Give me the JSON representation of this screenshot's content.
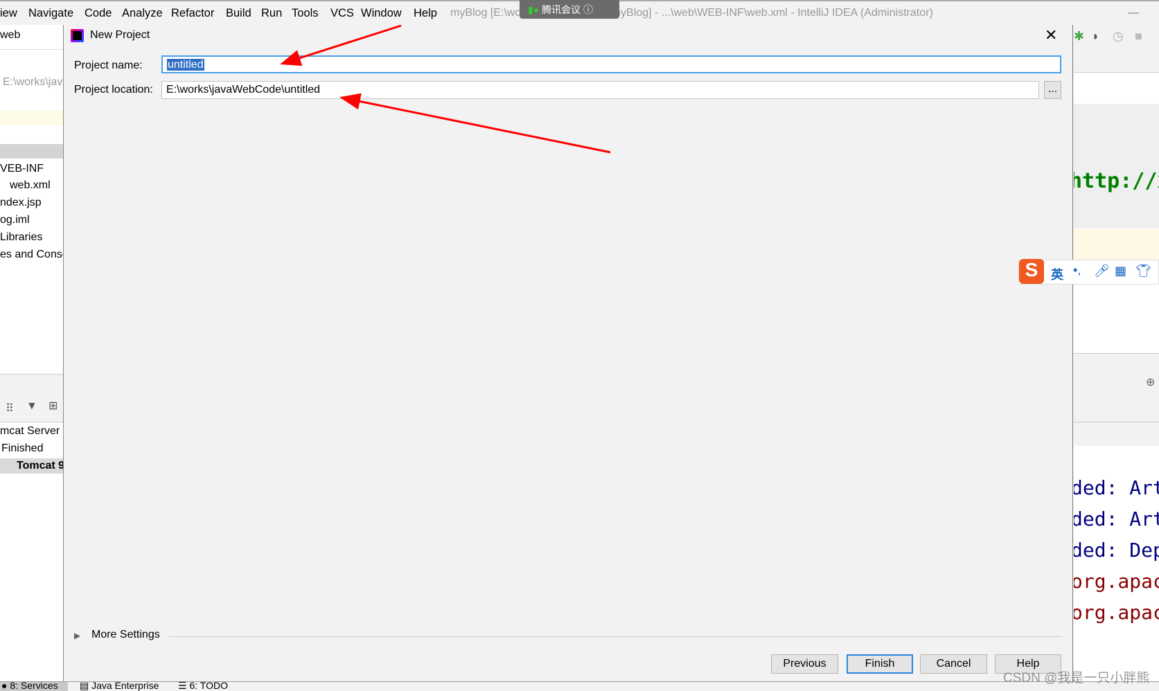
{
  "menubar": {
    "items": [
      "iew",
      "Navigate",
      "Code",
      "Analyze",
      "Refactor",
      "Build",
      "Run",
      "Tools",
      "VCS",
      "Window",
      "Help"
    ],
    "window_title": "myBlog [E:\\works\\javaWebCode\\myBlog] - ...\\web\\WEB-INF\\web.xml - IntelliJ IDEA (Administrator)",
    "overlay_label": "腾讯会议"
  },
  "left_panel": {
    "header": "web",
    "path": "E:\\works\\jav",
    "tree": [
      "VEB-INF",
      "web.xml",
      "ndex.jsp",
      "og.iml",
      "Libraries",
      "es and Consol"
    ],
    "services": [
      "mcat Server",
      "Finished",
      "Tomcat 9"
    ]
  },
  "dialog": {
    "title": "New Project",
    "project_name_label": "Project name:",
    "project_name_value": "untitled",
    "project_location_label": "Project location:",
    "project_location_value": "E:\\works\\javaWebCode\\untitled",
    "browse_label": "...",
    "more_settings": "More Settings",
    "buttons": {
      "previous": "Previous",
      "finish": "Finish",
      "cancel": "Cancel",
      "help": "Help"
    }
  },
  "editor": {
    "code": "http://x",
    "console": [
      {
        "text": "ded: Art",
        "color": "#000080"
      },
      {
        "text": "ded: Art",
        "color": "#000080"
      },
      {
        "text": "ded: Dep",
        "color": "#000080"
      },
      {
        "text": "org.apac",
        "color": "#8b0000"
      },
      {
        "text": "org.apac",
        "color": "#8b0000"
      }
    ],
    "ime_label": "英"
  },
  "status_bar": {
    "tabs": [
      "8: Services",
      "Java Enterprise",
      "6: TODO"
    ]
  },
  "watermark": "CSDN @我是一只小胖熊",
  "colors": {
    "accent": "#2e86de",
    "selection": "#2f6fc4",
    "arrow": "#ff0000"
  }
}
